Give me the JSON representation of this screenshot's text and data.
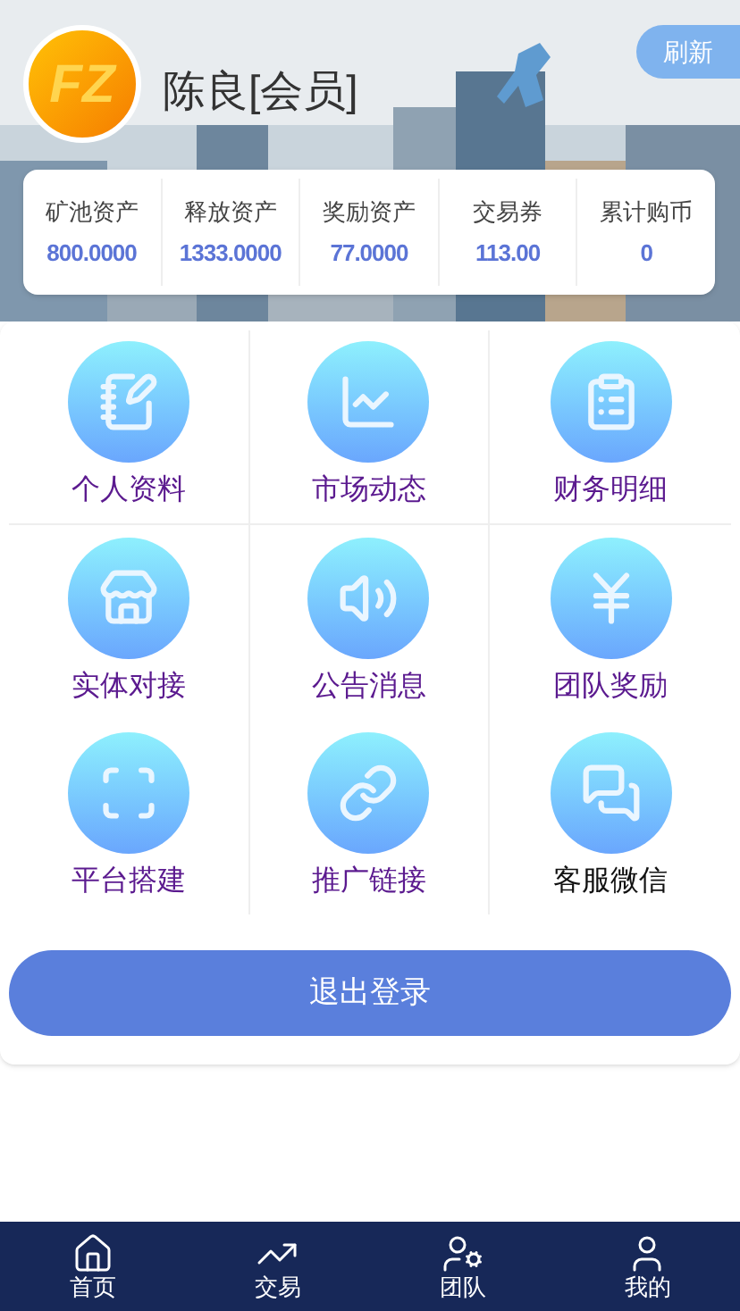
{
  "header": {
    "logo_text": "FZ",
    "user_name": "陈良[会员]",
    "refresh_button": "刷新"
  },
  "stats": [
    {
      "label": "矿池资产",
      "value": "800.0000"
    },
    {
      "label": "释放资产",
      "value": "1333.0000"
    },
    {
      "label": "奖励资产",
      "value": "77.0000"
    },
    {
      "label": "交易券",
      "value": "113.00"
    },
    {
      "label": "累计购币",
      "value": "0"
    }
  ],
  "menu": [
    {
      "label": "个人资料",
      "color": "#5b1a8f"
    },
    {
      "label": "市场动态",
      "color": "#5b1a8f"
    },
    {
      "label": "财务明细",
      "color": "#5b1a8f"
    },
    {
      "label": "实体对接",
      "color": "#5b1a8f"
    },
    {
      "label": "公告消息",
      "color": "#5b1a8f"
    },
    {
      "label": "团队奖励",
      "color": "#5b1a8f"
    },
    {
      "label": "平台搭建",
      "color": "#5b1a8f"
    },
    {
      "label": "推广链接",
      "color": "#5b1a8f"
    },
    {
      "label": "客服微信",
      "color": "#111111"
    }
  ],
  "logout_button": "退出登录",
  "bottom_nav": [
    {
      "label": "首页"
    },
    {
      "label": "交易"
    },
    {
      "label": "团队"
    },
    {
      "label": "我的"
    }
  ]
}
